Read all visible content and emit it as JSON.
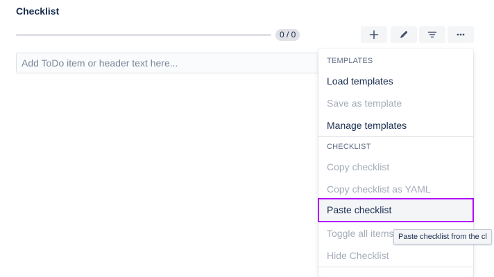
{
  "checklist": {
    "title": "Checklist",
    "progress": {
      "done": 0,
      "total": 0,
      "label": "0 / 0"
    },
    "toolbar": [
      {
        "id": "btn-add",
        "icon": "plus-icon"
      },
      {
        "id": "btn-edit",
        "icon": "pencil-icon"
      },
      {
        "id": "btn-filter",
        "icon": "filter-icon"
      },
      {
        "id": "btn-more",
        "icon": "more-horizontal-icon"
      }
    ],
    "add_input": {
      "placeholder": "Add ToDo item or header text here...",
      "value": ""
    }
  },
  "menu": {
    "templates_header": "TEMPLATES",
    "templates_items": [
      {
        "label": "Load templates",
        "enabled": true
      },
      {
        "label": "Save as template",
        "enabled": false
      },
      {
        "label": "Manage templates",
        "enabled": true
      }
    ],
    "checklist_header": "CHECKLIST",
    "checklist_items": [
      {
        "label": "Copy checklist",
        "enabled": false
      },
      {
        "label": "Copy checklist as YAML",
        "enabled": false
      },
      {
        "label": "Paste checklist",
        "enabled": true,
        "hovered": true
      },
      {
        "label": "Toggle all items",
        "enabled": false
      },
      {
        "label": "Hide Checklist",
        "enabled": false
      }
    ]
  },
  "tooltip": {
    "text": "Paste checklist from the cl"
  },
  "colors": {
    "text": "#172b4d",
    "muted": "#a5adba",
    "progress_track": "#dfe1e6",
    "hover_outline": "#b10dff"
  }
}
